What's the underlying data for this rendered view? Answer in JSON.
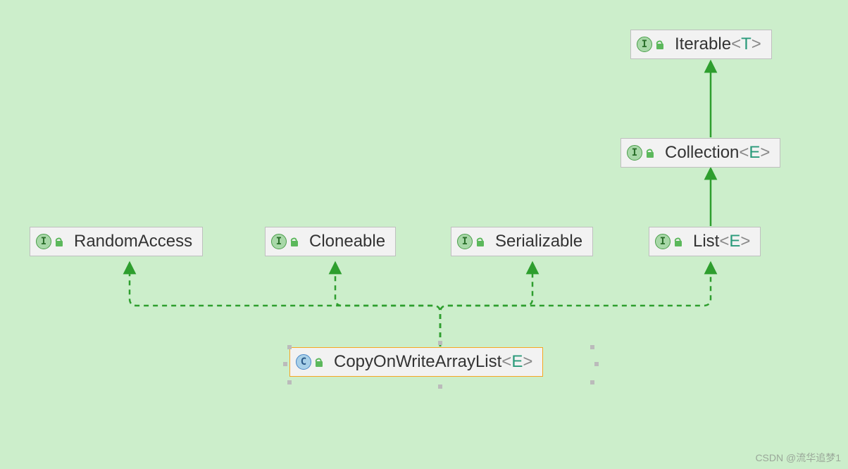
{
  "nodes": {
    "iterable": {
      "kind": "I",
      "name": "Iterable",
      "generic_open": "<",
      "param": "T",
      "generic_close": ">"
    },
    "collection": {
      "kind": "I",
      "name": "Collection",
      "generic_open": "<",
      "param": "E",
      "generic_close": ">"
    },
    "random": {
      "kind": "I",
      "name": "RandomAccess",
      "generic_open": "",
      "param": "",
      "generic_close": ""
    },
    "cloneable": {
      "kind": "I",
      "name": "Cloneable",
      "generic_open": "",
      "param": "",
      "generic_close": ""
    },
    "serial": {
      "kind": "I",
      "name": "Serializable",
      "generic_open": "",
      "param": "",
      "generic_close": ""
    },
    "list": {
      "kind": "I",
      "name": "List",
      "generic_open": "<",
      "param": "E",
      "generic_close": ">"
    },
    "cowal": {
      "kind": "C",
      "name": "CopyOnWriteArrayList",
      "generic_open": "<",
      "param": "E",
      "generic_close": ">"
    }
  },
  "edges": [
    {
      "from": "collection",
      "to": "iterable",
      "style": "solid"
    },
    {
      "from": "list",
      "to": "collection",
      "style": "solid"
    },
    {
      "from": "cowal",
      "to": "random",
      "style": "dashed"
    },
    {
      "from": "cowal",
      "to": "cloneable",
      "style": "dashed"
    },
    {
      "from": "cowal",
      "to": "serial",
      "style": "dashed"
    },
    {
      "from": "cowal",
      "to": "list",
      "style": "dashed"
    }
  ],
  "colors": {
    "arrow": "#2e9e2e",
    "bg": "#cceecb",
    "node_bg": "#f2f2f2",
    "node_border": "#bfbfbf",
    "selected_border": "#f5a623"
  },
  "watermark": "CSDN @流华追梦1"
}
